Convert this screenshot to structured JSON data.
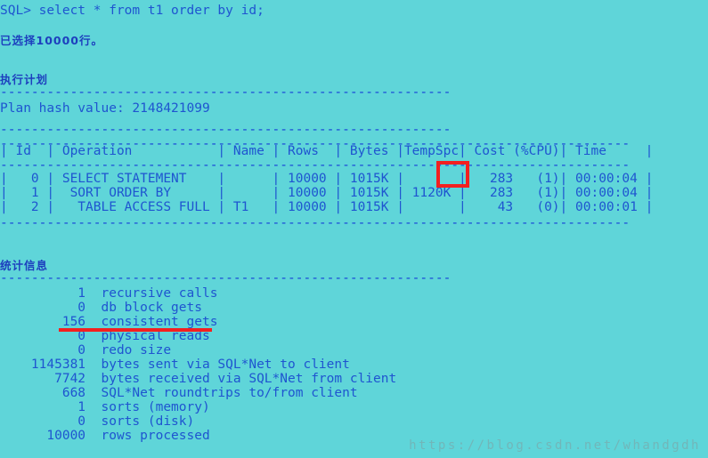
{
  "terminal": {
    "prompt_line": "SQL> select * from t1 order by id;",
    "rows_selected_message": "已选择10000行。",
    "execution_plan_heading": "执行计划",
    "separator_short": "----------------------------------------------------------",
    "plan_hash_line": "Plan hash value: 2148421099",
    "statistics_heading": "统计信息",
    "plan_table": {
      "top_border": "---------------------------------------------------------------------------------",
      "header_row": "| Id  | Operation           | Name | Rows  | Bytes |TempSpc| Cost (%CPU)| Time     |",
      "header_border": "---------------------------------------------------------------------------------",
      "rows": [
        "|   0 | SELECT STATEMENT    |      | 10000 | 1015K |       |   283   (1)| 00:00:04 |",
        "|   1 |  SORT ORDER BY      |      | 10000 | 1015K | 1120K |   283   (1)| 00:00:04 |",
        "|   2 |   TABLE ACCESS FULL | T1   | 10000 | 1015K |       |    43   (0)| 00:00:01 |"
      ],
      "bottom_border": "---------------------------------------------------------------------------------",
      "columns": [
        "Id",
        "Operation",
        "Name",
        "Rows",
        "Bytes",
        "TempSpc",
        "Cost (%CPU)",
        "Time"
      ],
      "data": [
        {
          "id": "0",
          "operation": "SELECT STATEMENT",
          "name": "",
          "rows": "10000",
          "bytes": "1015K",
          "tempspc": "",
          "cost": "283",
          "cpu": "(1)",
          "time": "00:00:04"
        },
        {
          "id": "1",
          "operation": "SORT ORDER BY",
          "name": "",
          "rows": "10000",
          "bytes": "1015K",
          "tempspc": "1120K",
          "cost": "283",
          "cpu": "(1)",
          "time": "00:00:04"
        },
        {
          "id": "2",
          "operation": "TABLE ACCESS FULL",
          "name": "T1",
          "rows": "10000",
          "bytes": "1015K",
          "tempspc": "",
          "cost": "43",
          "cpu": "(0)",
          "time": "00:00:01"
        }
      ]
    },
    "statistics": [
      {
        "value": "1",
        "label": "recursive calls"
      },
      {
        "value": "0",
        "label": "db block gets"
      },
      {
        "value": "156",
        "label": "consistent gets"
      },
      {
        "value": "0",
        "label": "physical reads"
      },
      {
        "value": "0",
        "label": "redo size"
      },
      {
        "value": "1145381",
        "label": "bytes sent via SQL*Net to client"
      },
      {
        "value": "7742",
        "label": "bytes received via SQL*Net from client"
      },
      {
        "value": "668",
        "label": "SQL*Net roundtrips to/from client"
      },
      {
        "value": "1",
        "label": "sorts (memory)"
      },
      {
        "value": "0",
        "label": "sorts (disk)"
      },
      {
        "value": "10000",
        "label": "rows processed"
      }
    ],
    "statistics_lines": [
      "          1  recursive calls",
      "          0  db block gets",
      "        156  consistent gets",
      "          0  physical reads",
      "          0  redo size",
      "    1145381  bytes sent via SQL*Net to client",
      "       7742  bytes received via SQL*Net from client",
      "        668  SQL*Net roundtrips to/from client",
      "          1  sorts (memory)",
      "          0  sorts (disk)",
      "      10000  rows processed"
    ]
  },
  "annotations": {
    "cost_highlight_value": "283",
    "underlined_statistic": "consistent gets",
    "highlight_color": "#f32020"
  },
  "watermark": {
    "text": "https://blog.csdn.net/whandgdh"
  },
  "colors": {
    "background": "#5fd5d9",
    "text": "#1f55d0",
    "heading": "#1d3fbe",
    "annotation": "#f32020",
    "watermark": "#78aaac"
  }
}
